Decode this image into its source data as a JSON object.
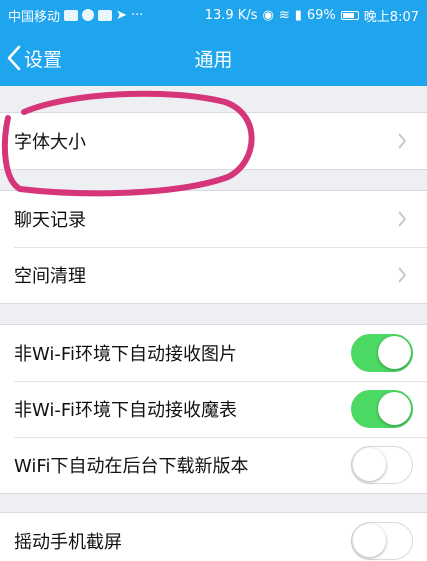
{
  "status_bar": {
    "carrier": "中国移动",
    "speed": "13.9 K/s",
    "battery": "69%",
    "time": "晚上8:07",
    "colors": {
      "background": "#1fa4ee",
      "text": "#ffffff"
    }
  },
  "nav": {
    "back_label": "设置",
    "title": "通用",
    "back_icon": "chevron-left-icon"
  },
  "groups": [
    {
      "rows": [
        {
          "label": "字体大小",
          "type": "disclosure"
        }
      ]
    },
    {
      "rows": [
        {
          "label": "聊天记录",
          "type": "disclosure"
        },
        {
          "label": "空间清理",
          "type": "disclosure"
        }
      ]
    },
    {
      "rows": [
        {
          "label": "非Wi-Fi环境下自动接收图片",
          "type": "toggle",
          "on": true
        },
        {
          "label": "非Wi-Fi环境下自动接收魔表",
          "type": "toggle",
          "on": true
        },
        {
          "label": "WiFi下自动在后台下载新版本",
          "type": "toggle",
          "on": false
        }
      ]
    },
    {
      "rows": [
        {
          "label": "摇动手机截屏",
          "type": "toggle",
          "on": false
        }
      ]
    }
  ],
  "colors": {
    "accent": "#1fa4ee",
    "toggle_on": "#4cd964",
    "annotation": "#d6357a",
    "page_background": "#eeeff3"
  }
}
